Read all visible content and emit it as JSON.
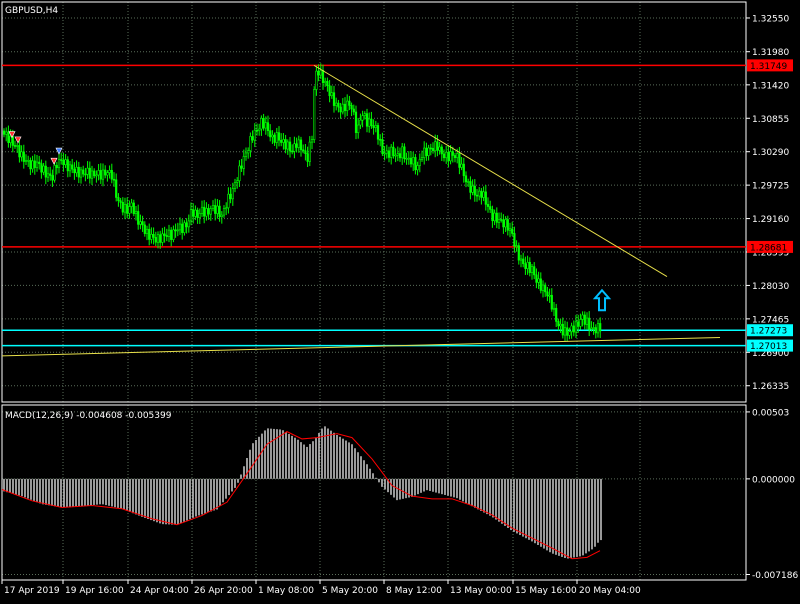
{
  "colors": {
    "background": "#000000",
    "grid": "#5a6e5a",
    "frame": "#ffffff",
    "candle": "#00ff00",
    "resistance_line": "#ff0000",
    "support_line": "#00ffff",
    "trendline": "#e8e04a",
    "arrow": "#00bfff",
    "macd_histogram": "#c0c0c0",
    "macd_signal": "#ff0000",
    "price_label_bg_red": "#ff0000",
    "price_label_bg_cyan": "#00ffff",
    "text": "#ffffff"
  },
  "chart_data": [
    {
      "panel": "price",
      "type": "candlestick",
      "symbol_label": "GBPUSD,H4",
      "ylim": [
        1.2606,
        1.3282
      ],
      "y_ticks": [
        "1.32550",
        "1.31980",
        "1.31420",
        "1.30855",
        "1.30290",
        "1.29725",
        "1.29160",
        "1.28595",
        "1.28030",
        "1.27465",
        "1.26900",
        "1.26335"
      ],
      "x_labels": [
        "17 Apr 2019",
        "19 Apr 16:00",
        "24 Apr 04:00",
        "26 Apr 20:00",
        "1 May 08:00",
        "5 May 20:00",
        "8 May 12:00",
        "13 May 00:00",
        "15 May 16:00",
        "20 May 04:00"
      ],
      "close_path": [
        [
          0,
          1.3064
        ],
        [
          5,
          1.3055
        ],
        [
          10,
          1.3045
        ],
        [
          15,
          1.3035
        ],
        [
          20,
          1.302
        ],
        [
          25,
          1.3012
        ],
        [
          30,
          1.3005
        ],
        [
          35,
          1.301
        ],
        [
          40,
          1.3
        ],
        [
          45,
          1.299
        ],
        [
          50,
          1.2985
        ],
        [
          55,
          1.301
        ],
        [
          60,
          1.3015
        ],
        [
          65,
          1.3005
        ],
        [
          70,
          1.3
        ],
        [
          75,
          1.2995
        ],
        [
          80,
          1.2992
        ],
        [
          85,
          1.2995
        ],
        [
          90,
          1.299
        ],
        [
          95,
          1.2992
        ],
        [
          100,
          1.299
        ],
        [
          105,
          1.2995
        ],
        [
          110,
          1.299
        ],
        [
          115,
          1.295
        ],
        [
          120,
          1.2935
        ],
        [
          125,
          1.293
        ],
        [
          130,
          1.294
        ],
        [
          135,
          1.2915
        ],
        [
          140,
          1.2905
        ],
        [
          145,
          1.289
        ],
        [
          150,
          1.2885
        ],
        [
          155,
          1.288
        ],
        [
          160,
          1.2885
        ],
        [
          165,
          1.289
        ],
        [
          170,
          1.2888
        ],
        [
          175,
          1.29
        ],
        [
          180,
          1.29
        ],
        [
          185,
          1.2905
        ],
        [
          190,
          1.293
        ],
        [
          195,
          1.292
        ],
        [
          200,
          1.293
        ],
        [
          205,
          1.2925
        ],
        [
          210,
          1.2935
        ],
        [
          215,
          1.293
        ],
        [
          220,
          1.292
        ],
        [
          225,
          1.2945
        ],
        [
          230,
          1.296
        ],
        [
          235,
          1.2985
        ],
        [
          240,
          1.301
        ],
        [
          245,
          1.303
        ],
        [
          250,
          1.3055
        ],
        [
          255,
          1.3065
        ],
        [
          260,
          1.308
        ],
        [
          265,
          1.307
        ],
        [
          270,
          1.305
        ],
        [
          275,
          1.3055
        ],
        [
          280,
          1.3045
        ],
        [
          285,
          1.304
        ],
        [
          290,
          1.303
        ],
        [
          295,
          1.3045
        ],
        [
          300,
          1.3035
        ],
        [
          305,
          1.3015
        ],
        [
          310,
          1.3055
        ],
        [
          312,
          1.313
        ],
        [
          315,
          1.317
        ],
        [
          320,
          1.3155
        ],
        [
          325,
          1.314
        ],
        [
          330,
          1.312
        ],
        [
          335,
          1.3105
        ],
        [
          340,
          1.31
        ],
        [
          345,
          1.311
        ],
        [
          350,
          1.3105
        ],
        [
          355,
          1.306
        ],
        [
          360,
          1.3095
        ],
        [
          365,
          1.308
        ],
        [
          370,
          1.3075
        ],
        [
          375,
          1.3065
        ],
        [
          380,
          1.303
        ],
        [
          385,
          1.3025
        ],
        [
          390,
          1.303
        ],
        [
          395,
          1.302
        ],
        [
          400,
          1.303
        ],
        [
          405,
          1.3015
        ],
        [
          410,
          1.3015
        ],
        [
          415,
          1.3
        ],
        [
          420,
          1.3025
        ],
        [
          425,
          1.303
        ],
        [
          430,
          1.3035
        ],
        [
          435,
          1.304
        ],
        [
          440,
          1.3025
        ],
        [
          445,
          1.302
        ],
        [
          450,
          1.3025
        ],
        [
          455,
          1.302
        ],
        [
          460,
          1.3
        ],
        [
          465,
          1.2975
        ],
        [
          470,
          1.2965
        ],
        [
          475,
          1.2955
        ],
        [
          480,
          1.296
        ],
        [
          485,
          1.294
        ],
        [
          490,
          1.292
        ],
        [
          495,
          1.2915
        ],
        [
          500,
          1.291
        ],
        [
          505,
          1.2905
        ],
        [
          510,
          1.289
        ],
        [
          515,
          1.286
        ],
        [
          520,
          1.284
        ],
        [
          525,
          1.2835
        ],
        [
          530,
          1.283
        ],
        [
          535,
          1.281
        ],
        [
          540,
          1.28
        ],
        [
          545,
          1.279
        ],
        [
          550,
          1.277
        ],
        [
          555,
          1.274
        ],
        [
          560,
          1.2728
        ],
        [
          565,
          1.2722
        ],
        [
          570,
          1.273
        ],
        [
          575,
          1.2735
        ],
        [
          580,
          1.275
        ],
        [
          585,
          1.274
        ],
        [
          590,
          1.2728
        ],
        [
          595,
          1.273
        ],
        [
          599,
          1.2733
        ]
      ],
      "horizontal_lines": [
        {
          "price": 1.31749,
          "label": "1.31749",
          "style": "red"
        },
        {
          "price": 1.28681,
          "label": "1.28681",
          "style": "red"
        },
        {
          "price": 1.27273,
          "label": "1.27273",
          "style": "cyan"
        },
        {
          "price": 1.27013,
          "label": "1.27013",
          "style": "cyan"
        }
      ],
      "trendlines": [
        {
          "from": [
            312,
            1.31749
          ],
          "to": [
            665,
            1.2818
          ]
        },
        {
          "from": [
            0,
            1.2684
          ],
          "to": [
            718,
            1.2715
          ]
        }
      ],
      "arrow": {
        "x": 600,
        "price": 1.2778,
        "direction": "up"
      },
      "markers": [
        {
          "x": 10,
          "price": 1.3058,
          "kind": "sell"
        },
        {
          "x": 16,
          "price": 1.3049,
          "kind": "sell"
        },
        {
          "x": 57,
          "price": 1.303,
          "kind": "buy"
        },
        {
          "x": 52,
          "price": 1.3013,
          "kind": "sell"
        }
      ]
    },
    {
      "panel": "indicator",
      "type": "histogram+line",
      "title": "MACD(12,26,9) -0.004608 -0.005399",
      "ylim": [
        -0.0076,
        0.00555
      ],
      "y_ticks": [
        "0.00503",
        "0.000000",
        "-0.007186"
      ],
      "histogram_path": [
        [
          0,
          -0.0009
        ],
        [
          20,
          -0.0013
        ],
        [
          40,
          -0.0019
        ],
        [
          60,
          -0.00215
        ],
        [
          80,
          -0.00205
        ],
        [
          100,
          -0.0019
        ],
        [
          120,
          -0.00225
        ],
        [
          140,
          -0.00285
        ],
        [
          160,
          -0.0034
        ],
        [
          175,
          -0.00345
        ],
        [
          195,
          -0.0028
        ],
        [
          215,
          -0.0023
        ],
        [
          235,
          -0.0005
        ],
        [
          250,
          0.0026
        ],
        [
          265,
          0.0038
        ],
        [
          280,
          0.0037
        ],
        [
          295,
          0.003
        ],
        [
          305,
          0.0024
        ],
        [
          312,
          0.0029
        ],
        [
          322,
          0.004
        ],
        [
          335,
          0.0033
        ],
        [
          350,
          0.0026
        ],
        [
          365,
          0.0011
        ],
        [
          380,
          -0.0006
        ],
        [
          395,
          -0.0016
        ],
        [
          410,
          -0.00135
        ],
        [
          425,
          -0.00085
        ],
        [
          440,
          -0.00115
        ],
        [
          455,
          -0.00145
        ],
        [
          470,
          -0.00205
        ],
        [
          490,
          -0.00285
        ],
        [
          510,
          -0.0039
        ],
        [
          530,
          -0.0047
        ],
        [
          550,
          -0.0056
        ],
        [
          565,
          -0.006
        ],
        [
          580,
          -0.0058
        ],
        [
          592,
          -0.0052
        ],
        [
          598,
          -0.0046
        ]
      ],
      "signal_path": [
        [
          0,
          -0.0008
        ],
        [
          30,
          -0.00165
        ],
        [
          60,
          -0.00215
        ],
        [
          90,
          -0.002
        ],
        [
          120,
          -0.00225
        ],
        [
          150,
          -0.003
        ],
        [
          175,
          -0.00345
        ],
        [
          200,
          -0.00275
        ],
        [
          225,
          -0.00175
        ],
        [
          245,
          0.0004
        ],
        [
          265,
          0.0026
        ],
        [
          285,
          0.00355
        ],
        [
          300,
          0.003
        ],
        [
          315,
          0.0031
        ],
        [
          335,
          0.0034
        ],
        [
          350,
          0.0031
        ],
        [
          370,
          0.0015
        ],
        [
          390,
          -0.0005
        ],
        [
          410,
          -0.0013
        ],
        [
          430,
          -0.0015
        ],
        [
          450,
          -0.0015
        ],
        [
          470,
          -0.002
        ],
        [
          490,
          -0.0027
        ],
        [
          510,
          -0.0037
        ],
        [
          530,
          -0.00445
        ],
        [
          550,
          -0.0052
        ],
        [
          570,
          -0.006
        ],
        [
          585,
          -0.0059
        ],
        [
          598,
          -0.0054
        ]
      ]
    }
  ]
}
